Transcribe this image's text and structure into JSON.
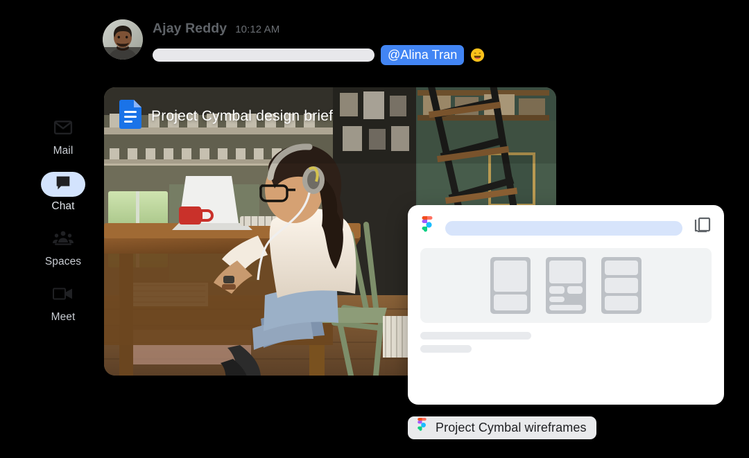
{
  "sidebar": {
    "items": [
      {
        "label": "Mail",
        "icon": "mail-icon",
        "active": false
      },
      {
        "label": "Chat",
        "icon": "chat-icon",
        "active": true
      },
      {
        "label": "Spaces",
        "icon": "spaces-icon",
        "active": false
      },
      {
        "label": "Meet",
        "icon": "meet-icon",
        "active": false
      }
    ],
    "active_pill_color": "#d3e3fd"
  },
  "message": {
    "avatar_icon": "user-avatar-photo",
    "sender": "Ajay Reddy",
    "timestamp": "10:12 AM",
    "body_placeholder_text": "",
    "mention": "@Alina Tran",
    "emoji": "smiling-face-with-smiling-eyes",
    "mention_color": "#4285f4"
  },
  "photo_card": {
    "doc_icon": "google-docs-icon",
    "doc_title": "Project Cymbal design brief",
    "image_alt": "Woman with headphones working on a laptop at a wooden desk in a home office"
  },
  "figma_card": {
    "app_icon": "figma-icon",
    "url_placeholder_text": "",
    "action_icon": "copy-icon",
    "wireframe": {
      "frames": [
        {
          "name": "frame-1",
          "blocks": [
            "large",
            "small"
          ]
        },
        {
          "name": "frame-2",
          "blocks": [
            "hero",
            "half",
            "half",
            "small",
            "wide"
          ]
        },
        {
          "name": "frame-3",
          "blocks": [
            "equal",
            "equal",
            "equal"
          ]
        }
      ]
    },
    "footer_line_1": "",
    "footer_line_2": ""
  },
  "tooltip": {
    "icon": "figma-icon",
    "label": "Project Cymbal wireframes",
    "background": "#e9eaec"
  }
}
